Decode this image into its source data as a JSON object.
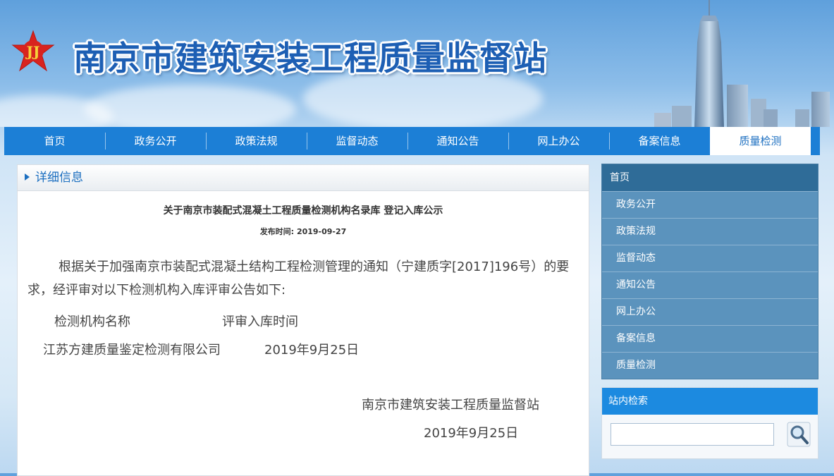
{
  "site": {
    "title": "南京市建筑安装工程质量监督站"
  },
  "nav": {
    "items": [
      "首页",
      "政务公开",
      "政策法规",
      "监督动态",
      "通知公告",
      "网上办公",
      "备案信息",
      "质量检测"
    ],
    "active": 7
  },
  "main": {
    "section_label": "详细信息",
    "article": {
      "title": "关于南京市装配式混凝土工程质量检测机构名录库 登记入库公示",
      "date_label": "发布时间:",
      "date": "2019-09-27",
      "paragraph": "根据关于加强南京市装配式混凝土结构工程检测管理的通知（宁建质字[2017]196号）的要求，经评审对以下检测机构入库评审公告如下:",
      "table": {
        "headers": [
          "检测机构名称",
          "评审入库时间"
        ],
        "rows": [
          [
            "江苏方建质量鉴定检测有限公司",
            "2019年9月25日"
          ]
        ]
      },
      "signature": "南京市建筑安装工程质量监督站",
      "signature_date": "2019年9月25日"
    }
  },
  "sidebar": {
    "head": "首页",
    "items": [
      "政务公开",
      "政策法规",
      "监督动态",
      "通知公告",
      "网上办公",
      "备案信息",
      "质量检测"
    ]
  },
  "search": {
    "title": "站内检索",
    "placeholder": "",
    "value": ""
  },
  "colors": {
    "nav_blue": "#1c7fd6",
    "title_blue": "#1d5fb4",
    "sidebar_blue": "#5b93bd",
    "logo_red": "#d8231f"
  }
}
